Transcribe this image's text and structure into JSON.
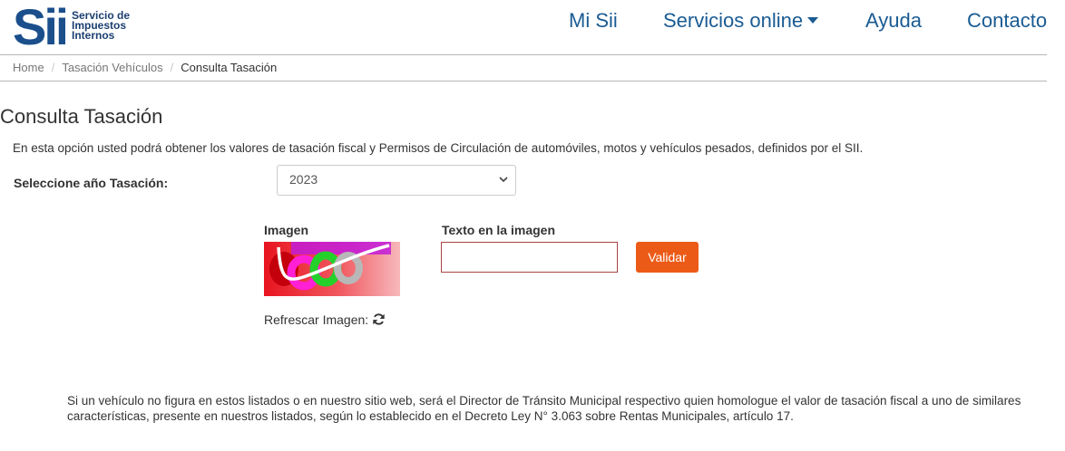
{
  "header": {
    "logo_mark": "Sii",
    "logo_lines": [
      "Servicio de",
      "Impuestos",
      "Internos"
    ],
    "nav": [
      {
        "label": "Mi Sii"
      },
      {
        "label": "Servicios online"
      },
      {
        "label": "Ayuda"
      },
      {
        "label": "Contacto"
      }
    ]
  },
  "breadcrumb": {
    "items": [
      "Home",
      "Tasación Vehículos",
      "Consulta Tasación"
    ],
    "separator": "/"
  },
  "main": {
    "title": "Consulta Tasación",
    "intro": "En esta opción usted podrá obtener los valores de tasación fiscal y Permisos de Circulación de automóviles, motos y vehículos pesados, definidos por el SII.",
    "year_label": "Seleccione año Tasación:",
    "year_selected": "2023",
    "image_label": "Imagen",
    "text_label": "Texto en la imagen",
    "captcha_value": "",
    "captcha_placeholder": "",
    "validate_label": "Validar",
    "refresh_label": "Refrescar Imagen:",
    "footer_note": "Si un vehículo no figura en estos listados o en nuestro sitio web, será el Director de Tránsito Municipal respectivo quien homologue el valor de tasación fiscal a uno de similares características, presente en nuestros listados, según lo establecido en el Decreto Ley N° 3.063 sobre Rentas Municipales, artículo 17."
  },
  "colors": {
    "brand_blue": "#1a5b93",
    "accent_orange": "#ec5a17",
    "error_border": "#a94442"
  },
  "icons": {
    "refresh": "refresh-icon",
    "dropdown": "caret-down-icon",
    "select": "chevron-down-icon"
  }
}
